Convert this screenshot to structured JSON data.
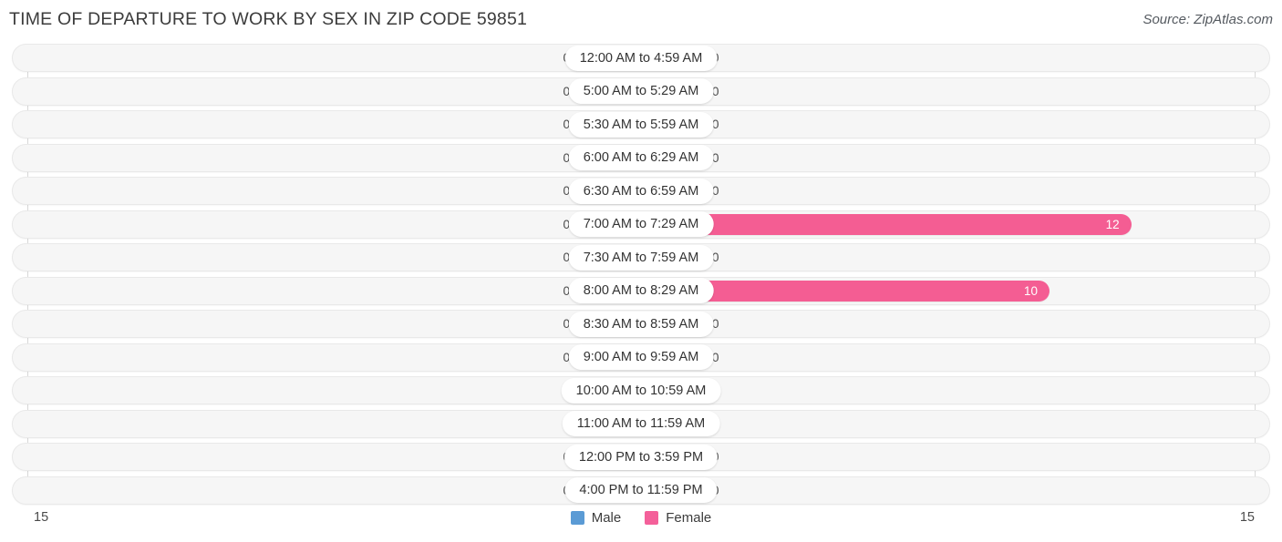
{
  "header": {
    "title": "TIME OF DEPARTURE TO WORK BY SEX IN ZIP CODE 59851",
    "source": "Source: ZipAtlas.com"
  },
  "legend": {
    "items": [
      {
        "label": "Male",
        "color": "#5b9bd5"
      },
      {
        "label": "Female",
        "color": "#f4609a"
      }
    ]
  },
  "axis": {
    "left_max": "15",
    "right_max": "15"
  },
  "colors": {
    "male_accent": "#5b9bd5",
    "male_muted": "#a8c8ec",
    "female_accent": "#f45d93",
    "female_muted": "#f8a8c8",
    "track": "#f6f6f6",
    "track_border": "#e9e9e9"
  },
  "chart_data": {
    "type": "bar",
    "subtype": "diverging-bidirectional",
    "title": "TIME OF DEPARTURE TO WORK BY SEX IN ZIP CODE 59851",
    "xlabel": "",
    "ylabel": "",
    "xlim": [
      15,
      15
    ],
    "axis_max": 15,
    "grid": false,
    "legend_position": "bottom-center",
    "categories": [
      "12:00 AM to 4:59 AM",
      "5:00 AM to 5:29 AM",
      "5:30 AM to 5:59 AM",
      "6:00 AM to 6:29 AM",
      "6:30 AM to 6:59 AM",
      "7:00 AM to 7:29 AM",
      "7:30 AM to 7:59 AM",
      "8:00 AM to 8:29 AM",
      "8:30 AM to 8:59 AM",
      "9:00 AM to 9:59 AM",
      "10:00 AM to 10:59 AM",
      "11:00 AM to 11:59 AM",
      "12:00 PM to 3:59 PM",
      "4:00 PM to 11:59 PM"
    ],
    "series": [
      {
        "name": "Male",
        "color": "#5b9bd5",
        "direction": "left",
        "values": [
          0,
          0,
          0,
          0,
          0,
          0,
          0,
          0,
          0,
          0,
          0,
          0,
          0,
          0
        ]
      },
      {
        "name": "Female",
        "color": "#f45d93",
        "direction": "right",
        "values": [
          0,
          0,
          0,
          0,
          0,
          12,
          0,
          10,
          0,
          0,
          0,
          0,
          0,
          0
        ]
      }
    ]
  }
}
